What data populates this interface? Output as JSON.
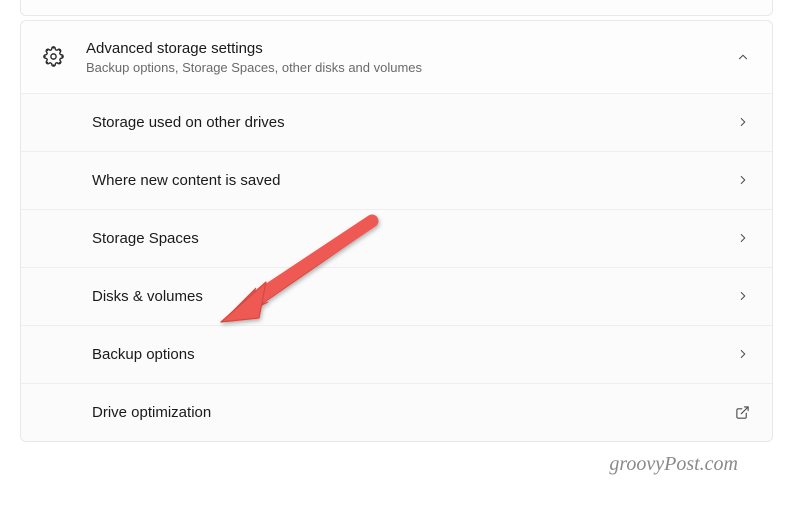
{
  "header": {
    "title": "Advanced storage settings",
    "subtitle": "Backup options, Storage Spaces, other disks and volumes"
  },
  "items": [
    {
      "label": "Storage used on other drives",
      "icon": "chevron-right"
    },
    {
      "label": "Where new content is saved",
      "icon": "chevron-right"
    },
    {
      "label": "Storage Spaces",
      "icon": "chevron-right"
    },
    {
      "label": "Disks & volumes",
      "icon": "chevron-right"
    },
    {
      "label": "Backup options",
      "icon": "chevron-right"
    },
    {
      "label": "Drive optimization",
      "icon": "external-link"
    }
  ],
  "watermark": "groovyPost.com",
  "colors": {
    "text_primary": "#1a1a1a",
    "text_secondary": "#6a6a6a",
    "border": "#e8e8e8",
    "arrow": "#ee5a52"
  }
}
